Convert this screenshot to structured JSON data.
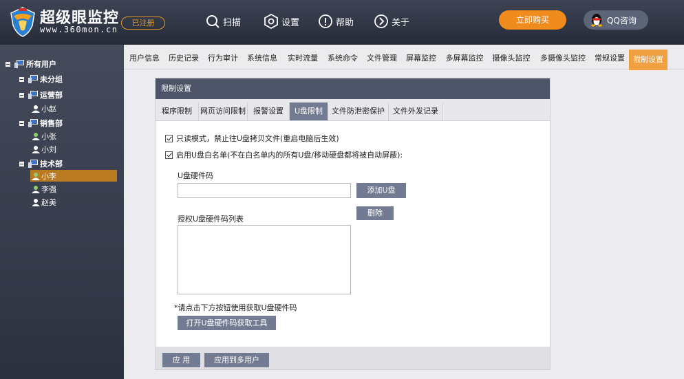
{
  "header": {
    "title": "超级眼监控",
    "url": "www.360mon.cn",
    "registered_badge": "已注册",
    "nav": [
      {
        "label": "扫描",
        "icon": "search-icon"
      },
      {
        "label": "设置",
        "icon": "gear-icon"
      },
      {
        "label": "帮助",
        "icon": "help-icon"
      },
      {
        "label": "关于",
        "icon": "about-icon"
      }
    ],
    "buy_button": "立即购买",
    "qq_button": "QQ咨询"
  },
  "sidebar": {
    "root": "所有用户",
    "groups": [
      {
        "label": "未分组",
        "users": []
      },
      {
        "label": "运营部",
        "users": [
          "小赵"
        ]
      },
      {
        "label": "销售部",
        "users": [
          "小张",
          "小刘"
        ]
      },
      {
        "label": "技术部",
        "users": [
          "小李",
          "李强",
          "赵美"
        ]
      }
    ],
    "selected_user": "小李"
  },
  "tabs": [
    "用户信息",
    "历史记录",
    "行为审计",
    "系统信息",
    "实时流量",
    "系统命令",
    "文件管理",
    "屏幕监控",
    "多屏幕监控",
    "摄像头监控",
    "多摄像头监控",
    "常规设置",
    "限制设置"
  ],
  "active_tab": "限制设置",
  "panel": {
    "title": "限制设置",
    "subtabs": [
      "程序限制",
      "网页访问限制",
      "报警设置",
      "U盘限制",
      "文件防泄密保护",
      "文件外发记录"
    ],
    "active_subtab": "U盘限制",
    "readonly_option": "只读模式，禁止往U盘拷贝文件(重启电脑后生效)",
    "whitelist_option": "启用U盘白名单(不在白名单内的所有U盘/移动硬盘都将被自动屏蔽):",
    "hardware_code_label": "U盘硬件码",
    "hardware_code_value": "",
    "add_button": "添加U盘",
    "delete_button": "删除",
    "list_label": "授权U盘硬件码列表",
    "hint": "*请点击下方按钮使用获取U盘硬件码",
    "tool_button": "打开U盘硬件码获取工具",
    "apply_button": "应 用",
    "apply_multi_button": "应用到多用户"
  },
  "colors": {
    "accent": "#f0a040",
    "header_dark": "#2b303d",
    "selected": "#b97a22",
    "button": "#737b92"
  }
}
